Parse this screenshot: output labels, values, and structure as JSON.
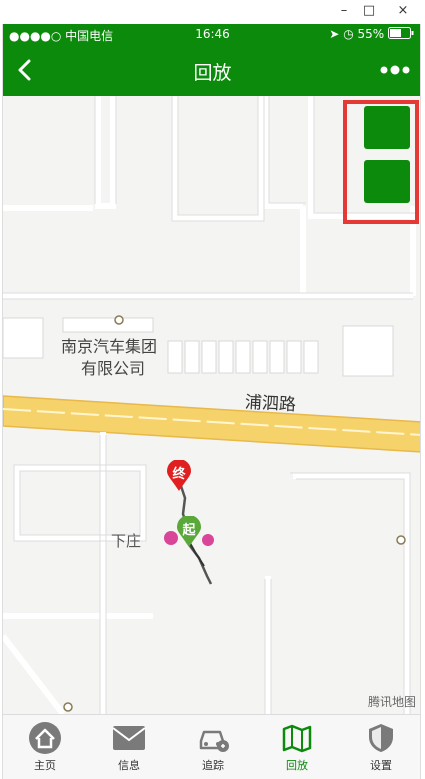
{
  "window_controls": {
    "minimize": "–",
    "maximize": "□",
    "close": "×"
  },
  "status_bar": {
    "carrier": "●●●●○ 中国电信",
    "time": "16:46",
    "battery": "55%"
  },
  "header": {
    "title": "回放"
  },
  "map": {
    "poi_line1": "南京汽车集团",
    "poi_line2": "有限公司",
    "road_name": "浦泗路",
    "village": "下庄",
    "attribution": "腾讯地图",
    "end_marker": "终",
    "start_marker": "起"
  },
  "tabs": [
    {
      "label": "主页",
      "icon": "home-icon",
      "active": false
    },
    {
      "label": "信息",
      "icon": "mail-icon",
      "active": false
    },
    {
      "label": "追踪",
      "icon": "car-icon",
      "active": false
    },
    {
      "label": "回放",
      "icon": "map-icon",
      "active": true
    },
    {
      "label": "设置",
      "icon": "shield-icon",
      "active": false
    }
  ],
  "colors": {
    "brand": "#0b8a0b",
    "highlight": "#e53935",
    "road": "#f6d26b"
  }
}
